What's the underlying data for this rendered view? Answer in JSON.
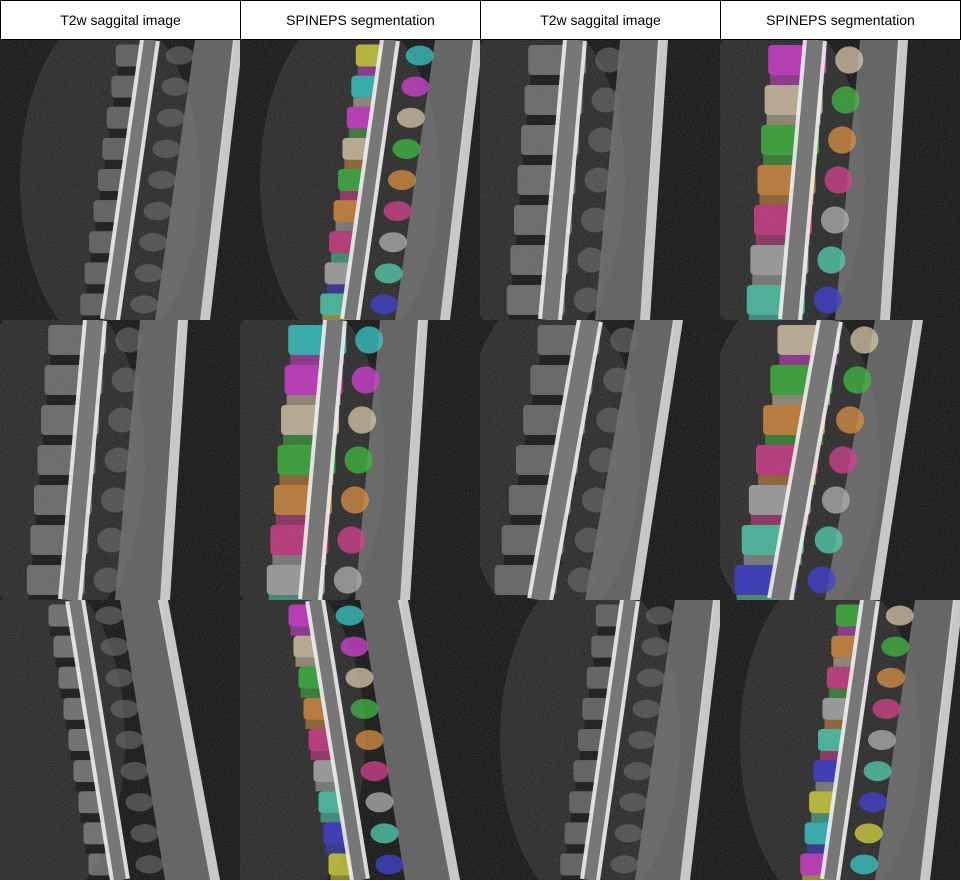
{
  "headers": [
    "T2w saggital image",
    "SPINEPS segmentation",
    "T2w saggital image",
    "SPINEPS segmentation"
  ],
  "palette": {
    "mask_colors": [
      "#3b3bd6",
      "#d6d63b",
      "#33c9c9",
      "#d63bd6",
      "#d9c7a8",
      "#3bb83b",
      "#d98c3b",
      "#d63b8c",
      "#b0b0b0",
      "#4fd0b0"
    ],
    "background": "#000000"
  },
  "rows": [
    {
      "cells": [
        {
          "type": "t2w",
          "region": "thoracic"
        },
        {
          "type": "seg",
          "region": "thoracic"
        },
        {
          "type": "t2w",
          "region": "lumbar"
        },
        {
          "type": "seg",
          "region": "lumbar"
        }
      ]
    },
    {
      "cells": [
        {
          "type": "t2w",
          "region": "lumbar"
        },
        {
          "type": "seg",
          "region": "lumbar"
        },
        {
          "type": "t2w",
          "region": "thoracolumbar"
        },
        {
          "type": "seg",
          "region": "thoracolumbar"
        }
      ]
    },
    {
      "cells": [
        {
          "type": "t2w",
          "region": "cervical"
        },
        {
          "type": "seg",
          "region": "cervical"
        },
        {
          "type": "t2w",
          "region": "thoracic"
        },
        {
          "type": "seg",
          "region": "thoracic"
        }
      ]
    }
  ]
}
